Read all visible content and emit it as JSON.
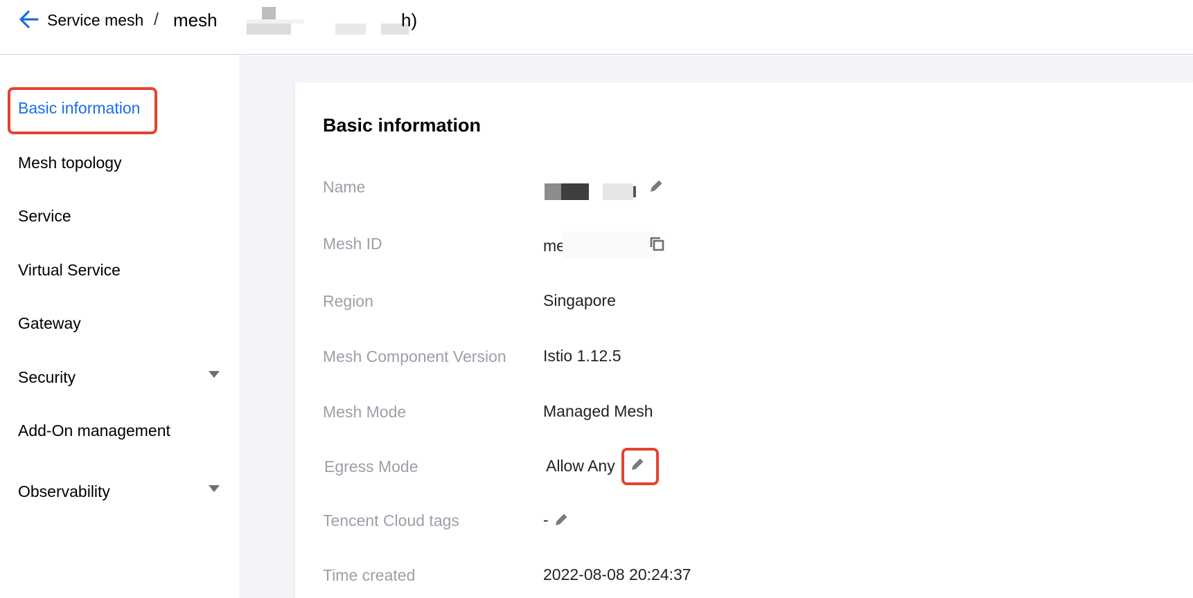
{
  "header": {
    "breadcrumb_root": "Service mesh",
    "separator": "/",
    "current_prefix": "mesh",
    "current_suffix": "h)"
  },
  "sidebar": {
    "items": [
      {
        "label": "Basic information",
        "active": true
      },
      {
        "label": "Mesh topology"
      },
      {
        "label": "Service"
      },
      {
        "label": "Virtual Service"
      },
      {
        "label": "Gateway"
      },
      {
        "label": "Security",
        "expandable": true
      },
      {
        "label": "Add-On management"
      },
      {
        "label": "Observability",
        "expandable": true
      }
    ]
  },
  "card": {
    "title": "Basic information",
    "fields": {
      "name": {
        "label": "Name",
        "value": ""
      },
      "mesh_id": {
        "label": "Mesh ID",
        "value": "me"
      },
      "region": {
        "label": "Region",
        "value": "Singapore"
      },
      "component_version": {
        "label": "Mesh Component Version",
        "value": "Istio 1.12.5"
      },
      "mesh_mode": {
        "label": "Mesh Mode",
        "value": "Managed Mesh"
      },
      "egress_mode": {
        "label": "Egress Mode",
        "value": "Allow Any"
      },
      "tags": {
        "label": "Tencent Cloud tags",
        "value": "-"
      },
      "time_created": {
        "label": "Time created",
        "value": "2022-08-08 20:24:37"
      }
    }
  },
  "icons": {
    "back": "arrow-left-icon",
    "edit": "pencil-icon",
    "copy": "copy-icon",
    "expand": "caret-down-icon"
  },
  "colors": {
    "accent": "#1a6de5",
    "highlight": "#e5432f",
    "label": "#9aa0a8",
    "background": "#f3f4f8"
  }
}
